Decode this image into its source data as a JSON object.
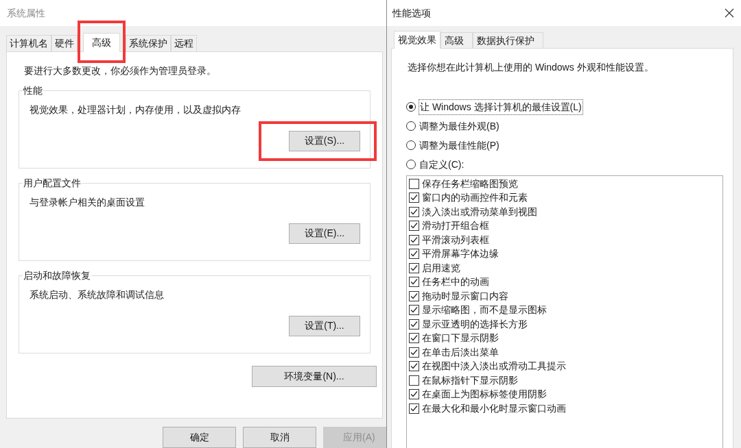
{
  "main_window": {
    "title": "系统属性",
    "tabs": [
      {
        "label": "计算机名",
        "selected": false,
        "highlighted": false
      },
      {
        "label": "硬件",
        "selected": false,
        "highlighted": false
      },
      {
        "label": "高级",
        "selected": true,
        "highlighted": true
      },
      {
        "label": "系统保护",
        "selected": false,
        "highlighted": false
      },
      {
        "label": "远程",
        "selected": false,
        "highlighted": false
      }
    ],
    "notice": "要进行大多数更改，你必须作为管理员登录。",
    "groups": [
      {
        "title": "性能",
        "description": "视觉效果，处理器计划，内存使用，以及虚拟内存",
        "button": "设置(S)...",
        "highlighted": true
      },
      {
        "title": "用户配置文件",
        "description": "与登录帐户相关的桌面设置",
        "button": "设置(E)...",
        "highlighted": false
      },
      {
        "title": "启动和故障恢复",
        "description": "系统启动、系统故障和调试信息",
        "button": "设置(T)...",
        "highlighted": false
      }
    ],
    "env_button": "环境变量(N)...",
    "footer_buttons": [
      {
        "label": "确定",
        "disabled": false
      },
      {
        "label": "取消",
        "disabled": false
      },
      {
        "label": "应用(A)",
        "disabled": true
      }
    ]
  },
  "options_window": {
    "title": "性能选项",
    "tabs": [
      {
        "label": "视觉效果",
        "selected": true
      },
      {
        "label": "高级",
        "selected": false
      },
      {
        "label": "数据执行保护",
        "selected": false
      }
    ],
    "description": "选择你想在此计算机上使用的 Windows 外观和性能设置。",
    "radios": [
      {
        "label": "让 Windows 选择计算机的最佳设置(L)",
        "selected": true
      },
      {
        "label": "调整为最佳外观(B)",
        "selected": false
      },
      {
        "label": "调整为最佳性能(P)",
        "selected": false
      },
      {
        "label": "自定义(C):",
        "selected": false
      }
    ],
    "effects": [
      {
        "label": "保存任务栏缩略图预览",
        "checked": false
      },
      {
        "label": "窗口内的动画控件和元素",
        "checked": true
      },
      {
        "label": "淡入淡出或滑动菜单到视图",
        "checked": true
      },
      {
        "label": "滑动打开组合框",
        "checked": true
      },
      {
        "label": "平滑滚动列表框",
        "checked": true
      },
      {
        "label": "平滑屏幕字体边缘",
        "checked": true
      },
      {
        "label": "启用速览",
        "checked": true
      },
      {
        "label": "任务栏中的动画",
        "checked": true
      },
      {
        "label": "拖动时显示窗口内容",
        "checked": true
      },
      {
        "label": "显示缩略图，而不是显示图标",
        "checked": true
      },
      {
        "label": "显示亚透明的选择长方形",
        "checked": true
      },
      {
        "label": "在窗口下显示阴影",
        "checked": true
      },
      {
        "label": "在单击后淡出菜单",
        "checked": true
      },
      {
        "label": "在视图中淡入淡出或滑动工具提示",
        "checked": true
      },
      {
        "label": "在鼠标指针下显示阴影",
        "checked": false
      },
      {
        "label": "在桌面上为图标标签使用阴影",
        "checked": true
      },
      {
        "label": "在最大化和最小化时显示窗口动画",
        "checked": true
      }
    ]
  }
}
